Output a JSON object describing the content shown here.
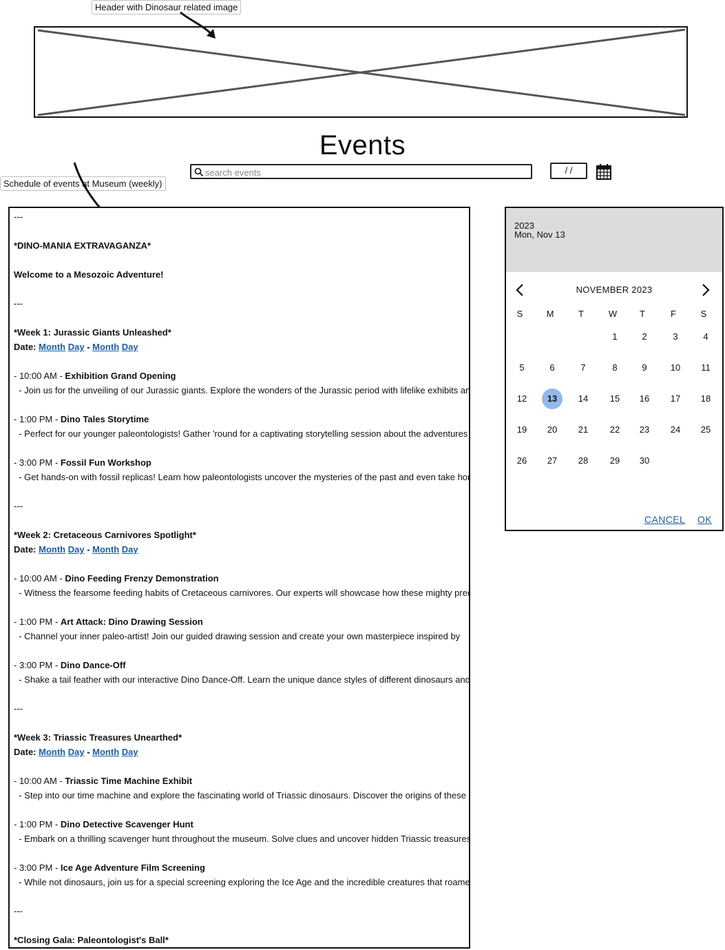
{
  "annotations": {
    "header_note": "Header with Dinosaur related image",
    "schedule_note": "Schedule of events at Museum (weekly)"
  },
  "page": {
    "title": "Events",
    "search_placeholder": "search events",
    "date_value": "/ /"
  },
  "schedule": {
    "lines": [
      {
        "kind": "plain",
        "text": "---"
      },
      {
        "kind": "bold",
        "text": "*DINO-MANIA EXTRAVAGANZA*"
      },
      {
        "kind": "bold",
        "text": "Welcome to a Mesozoic Adventure!"
      },
      {
        "kind": "plain",
        "text": "---"
      },
      {
        "kind": "bold",
        "text": "*Week 1: Jurassic Giants Unleashed*"
      },
      {
        "kind": "date",
        "prefix": "Date: ",
        "links": [
          "Month",
          "Day",
          "Month",
          "Day"
        ],
        "sep": " - "
      },
      {
        "kind": "time",
        "time": "- 10:00 AM - ",
        "title": "Exhibition Grand Opening"
      },
      {
        "kind": "plain",
        "text": "  - Join us for the unveiling of our Jurassic giants. Explore the wonders of the Jurassic period with lifelike exhibits and"
      },
      {
        "kind": "time",
        "time": "- 1:00 PM - ",
        "title": "Dino Tales Storytime"
      },
      {
        "kind": "plain",
        "text": "  - Perfect for our younger paleontologists! Gather 'round for a captivating storytelling session about the adventures"
      },
      {
        "kind": "time",
        "time": "- 3:00 PM - ",
        "title": "Fossil Fun Workshop"
      },
      {
        "kind": "plain",
        "text": "  - Get hands-on with fossil replicas! Learn how paleontologists uncover the mysteries of the past and even take home"
      },
      {
        "kind": "plain",
        "text": "---"
      },
      {
        "kind": "bold",
        "text": "*Week 2: Cretaceous Carnivores Spotlight*"
      },
      {
        "kind": "date",
        "prefix": "Date: ",
        "links": [
          "Month",
          "Day",
          "Month",
          "Day"
        ],
        "sep": " - "
      },
      {
        "kind": "time",
        "time": "- 10:00 AM - ",
        "title": "Dino Feeding Frenzy Demonstration"
      },
      {
        "kind": "plain",
        "text": "  - Witness the fearsome feeding habits of Cretaceous carnivores. Our experts will showcase how these mighty predators"
      },
      {
        "kind": "time",
        "time": "- 1:00 PM - ",
        "title": "Art Attack: Dino Drawing Session"
      },
      {
        "kind": "plain",
        "text": "  - Channel your inner paleo-artist! Join our guided drawing session and create your own masterpiece inspired by"
      },
      {
        "kind": "time",
        "time": "- 3:00 PM - ",
        "title": "Dino Dance-Off"
      },
      {
        "kind": "plain",
        "text": "  - Shake a tail feather with our interactive Dino Dance-Off. Learn the unique dance styles of different dinosaurs and"
      },
      {
        "kind": "plain",
        "text": "---"
      },
      {
        "kind": "bold",
        "text": "*Week 3: Triassic Treasures Unearthed*"
      },
      {
        "kind": "date",
        "prefix": "Date: ",
        "links": [
          "Month",
          "Day",
          "Month",
          "Day"
        ],
        "sep": " - "
      },
      {
        "kind": "time",
        "time": "- 10:00 AM - ",
        "title": "Triassic Time Machine Exhibit"
      },
      {
        "kind": "plain",
        "text": "  - Step into our time machine and explore the fascinating world of Triassic dinosaurs. Discover the origins of these"
      },
      {
        "kind": "time",
        "time": "- 1:00 PM - ",
        "title": "Dino Detective Scavenger Hunt"
      },
      {
        "kind": "plain",
        "text": "  - Embark on a thrilling scavenger hunt throughout the museum. Solve clues and uncover hidden Triassic treasures"
      },
      {
        "kind": "time",
        "time": "- 3:00 PM - ",
        "title": "Ice Age Adventure Film Screening"
      },
      {
        "kind": "plain",
        "text": "  - While not dinosaurs, join us for a special screening exploring the Ice Age and the incredible creatures that roamed"
      },
      {
        "kind": "plain",
        "text": "---"
      },
      {
        "kind": "bold",
        "text": "*Closing Gala: Paleontologist's Ball*"
      }
    ]
  },
  "datepicker": {
    "year": "2023",
    "selected_date_label": "Mon, Nov 13",
    "month_label": "NOVEMBER 2023",
    "weekdays": [
      "S",
      "M",
      "T",
      "W",
      "T",
      "F",
      "S"
    ],
    "first_weekday_index": 3,
    "days_in_month": 30,
    "selected_day": 13,
    "cancel_label": "CANCEL",
    "ok_label": "OK"
  },
  "colors": {
    "link": "#1a5fa8",
    "selected_day": "#93b8ec",
    "picker_header": "#dcdcdc"
  }
}
